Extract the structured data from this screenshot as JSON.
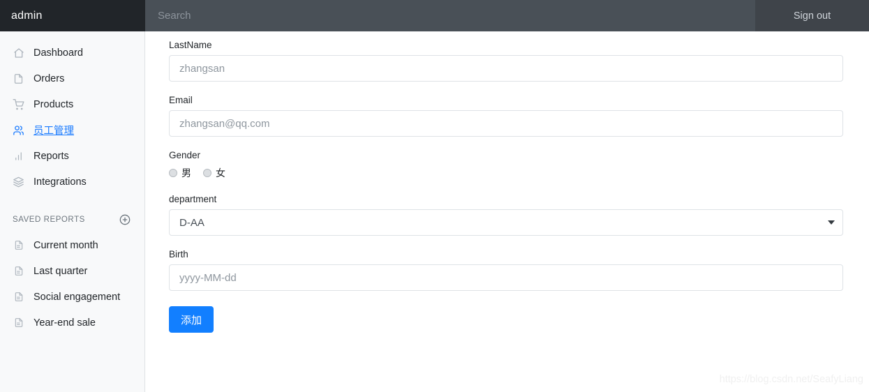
{
  "topbar": {
    "brand": "admin",
    "search_placeholder": "Search",
    "search_value": "",
    "signout_label": "Sign out"
  },
  "sidebar": {
    "items": [
      {
        "label": "Dashboard",
        "icon": "home-icon",
        "active": false
      },
      {
        "label": "Orders",
        "icon": "file-icon",
        "active": false
      },
      {
        "label": "Products",
        "icon": "cart-icon",
        "active": false
      },
      {
        "label": "员工管理",
        "icon": "people-icon",
        "active": true
      },
      {
        "label": "Reports",
        "icon": "bar-chart-icon",
        "active": false
      },
      {
        "label": "Integrations",
        "icon": "layers-icon",
        "active": false
      }
    ],
    "section": {
      "title": "SAVED REPORTS",
      "add_icon": "plus-circle-icon",
      "items": [
        {
          "label": "Current month",
          "icon": "file-icon"
        },
        {
          "label": "Last quarter",
          "icon": "file-icon"
        },
        {
          "label": "Social engagement",
          "icon": "file-icon"
        },
        {
          "label": "Year-end sale",
          "icon": "file-icon"
        }
      ]
    }
  },
  "form": {
    "lastname": {
      "label": "LastName",
      "placeholder": "zhangsan",
      "value": ""
    },
    "email": {
      "label": "Email",
      "placeholder": "zhangsan@qq.com",
      "value": ""
    },
    "gender": {
      "label": "Gender",
      "options": [
        {
          "label": "男",
          "selected": false
        },
        {
          "label": "女",
          "selected": false
        }
      ]
    },
    "department": {
      "label": "department",
      "selected": "D-AA",
      "caret_icon": "chevron-down-icon"
    },
    "birth": {
      "label": "Birth",
      "placeholder": "yyyy-MM-dd",
      "value": ""
    },
    "submit_label": "添加"
  },
  "watermark": "https://blog.csdn.net/SeafyLiang",
  "colors": {
    "topbar": "#495057",
    "brand_bg": "#212529",
    "sidebar_bg": "#f8f9fa",
    "accent": "#127fff",
    "active_link": "#1a7bff"
  }
}
